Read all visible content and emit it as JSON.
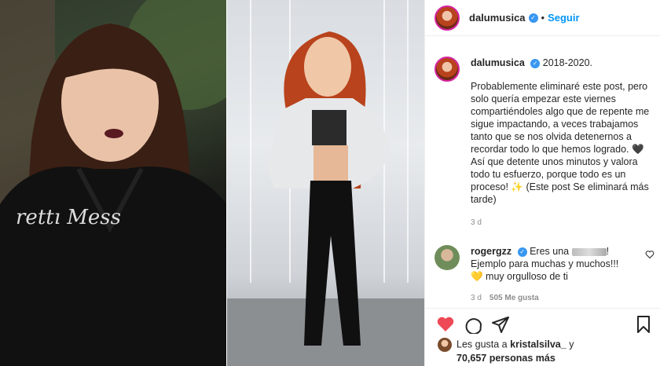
{
  "header": {
    "username": "dalumusica",
    "follow_label": "Seguir"
  },
  "caption": {
    "username": "dalumusica",
    "years": "2018-2020.",
    "text": "Probablemente eliminaré este post, pero solo quería empezar este viernes compartiéndoles algo que de repente me sigue impactando, a veces trabajamos tanto que se nos olvida detenernos a recordar todo lo que hemos logrado. 🖤 Así que detente unos minutos y valora todo tu esfuerzo, porque todo es un proceso! ✨ (Este post Se eliminará más tarde)",
    "timestamp": "3 d"
  },
  "comment": {
    "username": "rogergzz",
    "text_start": "Eres una",
    "text_rest": "Ejemplo para muchas y muchos!!!",
    "text_end": "💛 muy orgulloso de ti",
    "time": "3 d",
    "likes": "505 Me gusta"
  },
  "likes": {
    "prefix": "Les gusta a",
    "user": "kristalsilva_",
    "suffix": "y",
    "count": "70,657 personas más"
  },
  "colors": {
    "accent": "#0095f6",
    "heart": "#ed4956",
    "verified": "#3897f0"
  },
  "icons": [
    "verified-badge-icon",
    "heart-icon",
    "comment-icon",
    "share-icon",
    "bookmark-icon"
  ]
}
